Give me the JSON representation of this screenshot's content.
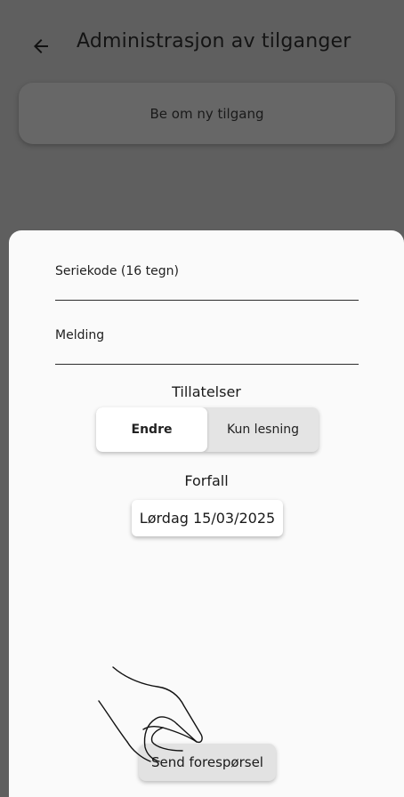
{
  "header": {
    "title": "Administrasjon av tilganger",
    "back_icon": "arrow-left-icon"
  },
  "background": {
    "request_card_label": "Be om ny tilgang"
  },
  "sheet": {
    "serial_label": "Seriekode (16 tegn)",
    "message_label": "Melding",
    "permissions_title": "Tillatelser",
    "permissions_options": [
      "Endre",
      "Kun lesning"
    ],
    "permissions_selected": "Endre",
    "due_title": "Forfall",
    "due_date": "Lørdag 15/03/2025",
    "send_label": "Send forespørsel"
  },
  "overlay": {
    "hand_icon": "tap-hand-icon"
  },
  "colors": {
    "scrim": "#5f5f5f",
    "sheet_bg": "#fafafa",
    "segment_bg": "#e4e4e4",
    "button_bg": "#e2e2e2"
  }
}
